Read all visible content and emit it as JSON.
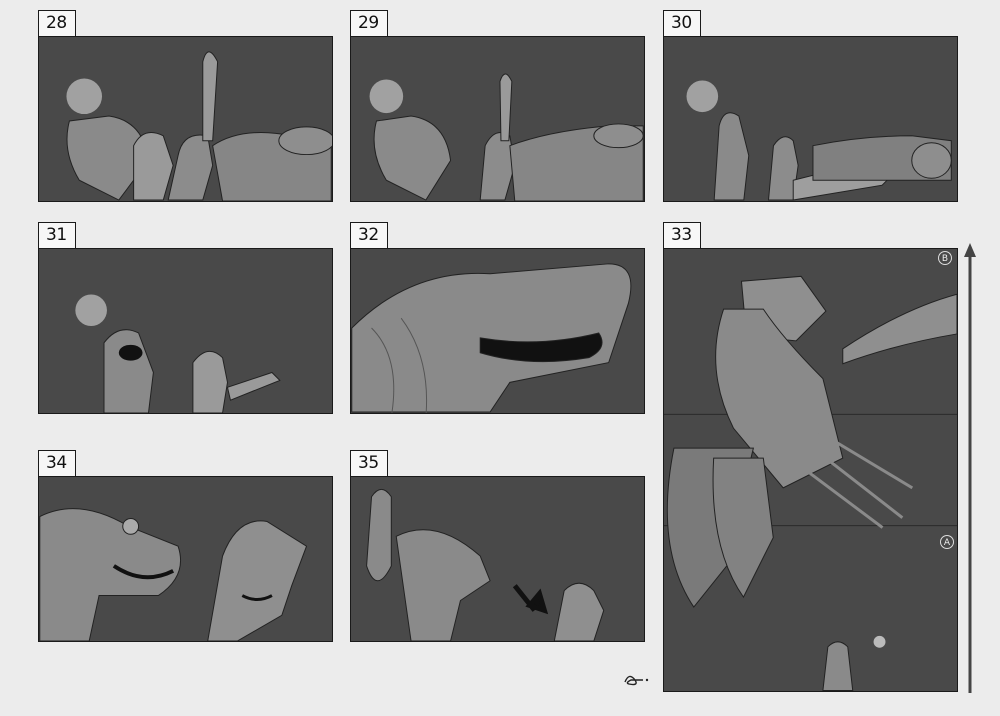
{
  "storyboard": {
    "panels": [
      {
        "number": "28"
      },
      {
        "number": "29"
      },
      {
        "number": "30"
      },
      {
        "number": "31"
      },
      {
        "number": "32"
      },
      {
        "number": "33"
      },
      {
        "number": "34"
      },
      {
        "number": "35"
      }
    ],
    "panel_33_markers": {
      "top": "B",
      "bottom": "A"
    },
    "colors": {
      "page": "#ececec",
      "panel_bg": "#494949",
      "sketch": "#9a9a9a",
      "line": "#1a1a1a",
      "label_bg": "#f7f7f7"
    },
    "icons": [
      "signature-mark",
      "camera-move-arrow-icon",
      "action-arrow-icon"
    ]
  }
}
